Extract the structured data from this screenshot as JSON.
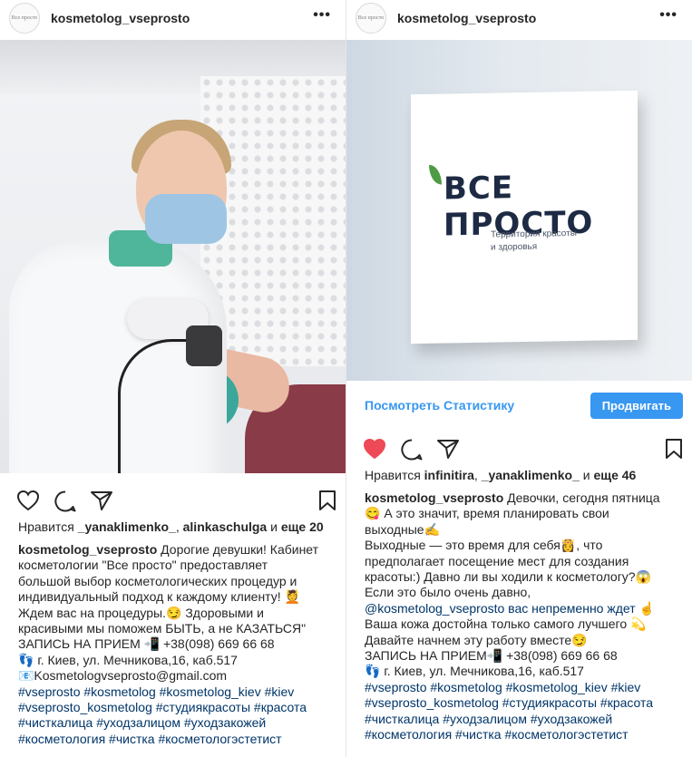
{
  "left_post": {
    "username": "kosmetolog_vseprosto",
    "avatar_text": "Все просто",
    "more_icon": "more-dots-icon",
    "likes": {
      "prefix": "Нравится",
      "user1": "_yanaklimenko_",
      "sep": ",",
      "user2": "alinkaschulga",
      "and": "и",
      "others": "еще 20"
    },
    "caption_user": "kosmetolog_vseprosto",
    "caption_lines": [
      "Дорогие девушки! Кабинет",
      "косметологии \"Все просто\" предоставляет",
      "большой выбор косметологических процедур и",
      "индивидуальный подход к каждому клиенту! 💆",
      "Ждем вас на процедуры.😏 Здоровыми и",
      "красивыми мы поможем БЫТЬ, а не КАЗАТЬСЯ\"",
      "ЗАПИСЬ НА ПРИЕМ 📲 +38(098) 669 66 68",
      "👣 г. Киев, ул. Мечникова,16, каб.517",
      "📧Kosmetologvseprosto@gmail.com"
    ],
    "hashtag_lines": [
      "#vseprosto #kosmetolog #kosmetolog_kiev #kiev",
      "#vseprosto_kosmetolog #студиякрасоты #красота",
      "#чисткалица #уходзалицом #уходзакожей",
      "#косметология #чистка #косметологэстетист"
    ]
  },
  "right_post": {
    "username": "kosmetolog_vseprosto",
    "avatar_text": "Все просто",
    "more_icon": "more-dots-icon",
    "sign": {
      "title": "ВСЕ ПРОСТО",
      "subtitle_1": "Территория красоты",
      "subtitle_2": "и здоровья"
    },
    "stats_link": "Посмотреть Статистику",
    "promote_button": "Продвигать",
    "likes": {
      "prefix": "Нравится",
      "user1": "infinitira",
      "sep": ",",
      "user2": "_yanaklimenko_",
      "and": "и",
      "others": "еще 46"
    },
    "caption_user": "kosmetolog_vseprosto",
    "caption_first": "Девочки, сегодня пятница",
    "caption_lines": [
      "😋 А это значит, время планировать свои",
      "выходные✍",
      "Выходные — это время для себя👸, что",
      "предполагает посещение мест для создания",
      "красоты:) Давно ли вы ходили к косметологу?😱",
      "Если это было очень давно,",
      "@kosmetolog_vseprosto  вас непременно ждет ☝",
      "Ваша кожа достойна только самого лучшего 💫",
      "Давайте начнем эту работу вместе😏",
      "ЗАПИСЬ НА ПРИЕМ📲 +38(098) 669 66 68",
      "👣 г. Киев, ул. Мечникова,16, каб.517"
    ],
    "hashtag_lines": [
      "#vseprosto #kosmetolog #kosmetolog_kiev #kiev",
      "#vseprosto_kosmetolog #студиякрасоты #красота",
      "#чисткалица #уходзалицом #уходзакожей",
      "#косметология #чистка #косметологэстетист"
    ],
    "liked": true
  },
  "colors": {
    "link_blue": "#3897f0",
    "hashtag": "#003569",
    "heart_red": "#ed4956",
    "text": "#262626"
  }
}
